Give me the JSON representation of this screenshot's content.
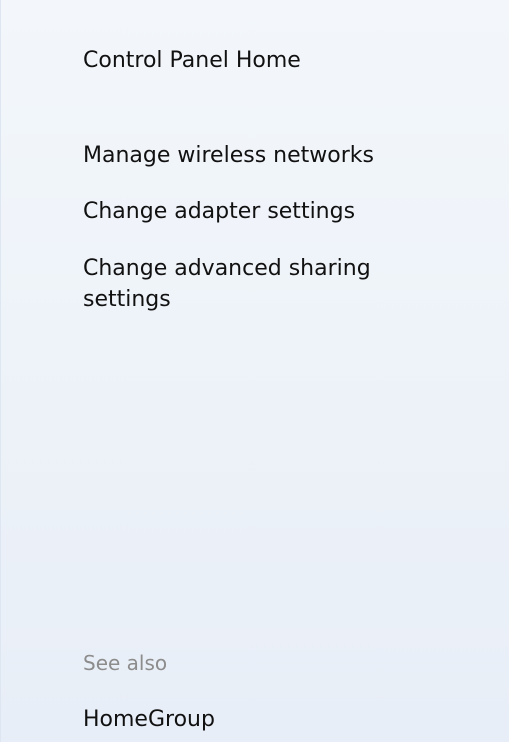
{
  "task_pane": {
    "home_link": "Control Panel Home",
    "links": [
      "Manage wireless networks",
      "Change adapter settings",
      "Change advanced sharing settings"
    ],
    "see_also": {
      "label": "See also",
      "links": [
        "HomeGroup"
      ]
    }
  }
}
